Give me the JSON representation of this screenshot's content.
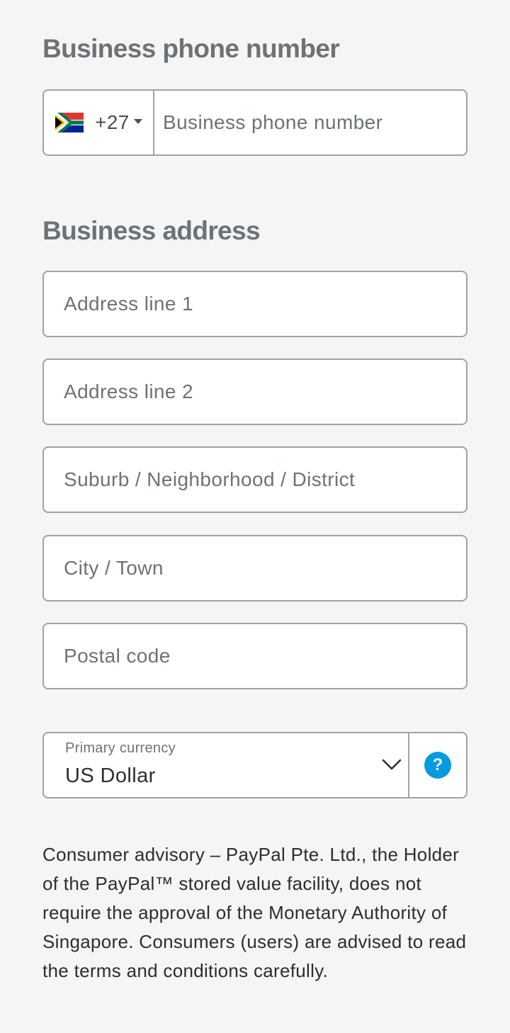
{
  "phone_section": {
    "title": "Business phone number",
    "country_code": "+27",
    "country_flag": "south-africa-flag",
    "phone_placeholder": "Business phone number"
  },
  "address_section": {
    "title": "Business address",
    "address_line_1_placeholder": "Address line 1",
    "address_line_2_placeholder": "Address line 2",
    "suburb_placeholder": "Suburb / Neighborhood / District",
    "city_placeholder": "City / Town",
    "postal_code_placeholder": "Postal code"
  },
  "currency": {
    "label": "Primary currency",
    "selected": "US Dollar",
    "help_glyph": "?"
  },
  "advisory": {
    "text": "Consumer advisory – PayPal Pte. Ltd., the Holder of the PayPal™ stored value facility, does not require the approval of the Monetary Authority of Singapore. Consumers (users) are advised to read the terms and conditions carefully."
  },
  "colors": {
    "heading": "#6c7378",
    "border": "#9da3a6",
    "help_icon": "#009cde",
    "text": "#2c2e2f"
  }
}
